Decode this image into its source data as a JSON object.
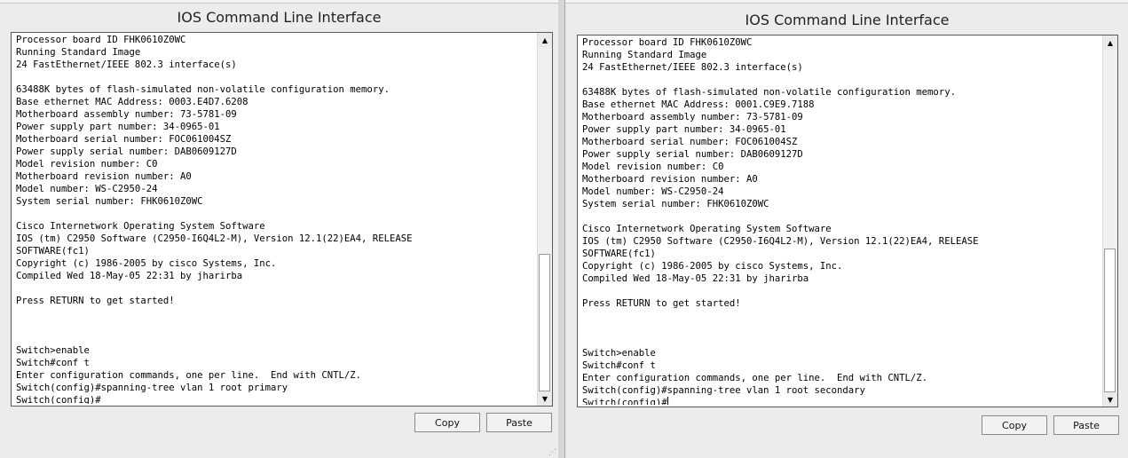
{
  "windows": [
    {
      "title": "IOS Command Line Interface",
      "lines": [
        "Processor board ID FHK0610Z0WC",
        "Running Standard Image",
        "24 FastEthernet/IEEE 802.3 interface(s)",
        "",
        "63488K bytes of flash-simulated non-volatile configuration memory.",
        "Base ethernet MAC Address: 0003.E4D7.6208",
        "Motherboard assembly number: 73-5781-09",
        "Power supply part number: 34-0965-01",
        "Motherboard serial number: FOC061004SZ",
        "Power supply serial number: DAB0609127D",
        "Model revision number: C0",
        "Motherboard revision number: A0",
        "Model number: WS-C2950-24",
        "System serial number: FHK0610Z0WC",
        "",
        "Cisco Internetwork Operating System Software",
        "IOS (tm) C2950 Software (C2950-I6Q4L2-M), Version 12.1(22)EA4, RELEASE",
        "SOFTWARE(fc1)",
        "Copyright (c) 1986-2005 by cisco Systems, Inc.",
        "Compiled Wed 18-May-05 22:31 by jharirba",
        "",
        "Press RETURN to get started!",
        "",
        "",
        "",
        "Switch>enable",
        "Switch#conf t",
        "Enter configuration commands, one per line.  End with CNTL/Z.",
        "Switch(config)#spanning-tree vlan 1 root primary",
        "Switch(config)#"
      ],
      "copy_label": "Copy",
      "paste_label": "Paste",
      "scroll_position": 1.0,
      "scroll_visible_fraction": 0.4
    },
    {
      "title": "IOS Command Line Interface",
      "lines": [
        "Processor board ID FHK0610Z0WC",
        "Running Standard Image",
        "24 FastEthernet/IEEE 802.3 interface(s)",
        "",
        "63488K bytes of flash-simulated non-volatile configuration memory.",
        "Base ethernet MAC Address: 0001.C9E9.7188",
        "Motherboard assembly number: 73-5781-09",
        "Power supply part number: 34-0965-01",
        "Motherboard serial number: FOC061004SZ",
        "Power supply serial number: DAB0609127D",
        "Model revision number: C0",
        "Motherboard revision number: A0",
        "Model number: WS-C2950-24",
        "System serial number: FHK0610Z0WC",
        "",
        "Cisco Internetwork Operating System Software",
        "IOS (tm) C2950 Software (C2950-I6Q4L2-M), Version 12.1(22)EA4, RELEASE",
        "SOFTWARE(fc1)",
        "Copyright (c) 1986-2005 by cisco Systems, Inc.",
        "Compiled Wed 18-May-05 22:31 by jharirba",
        "",
        "Press RETURN to get started!",
        "",
        "",
        "",
        "Switch>enable",
        "Switch#conf t",
        "Enter configuration commands, one per line.  End with CNTL/Z.",
        "Switch(config)#spanning-tree vlan 1 root secondary",
        "Switch(config)#"
      ],
      "copy_label": "Copy",
      "paste_label": "Paste",
      "scroll_position": 1.0,
      "scroll_visible_fraction": 0.42
    }
  ],
  "icons": {
    "scroll_up": "▲",
    "scroll_down": "▼",
    "resize_grip": "⋰"
  }
}
